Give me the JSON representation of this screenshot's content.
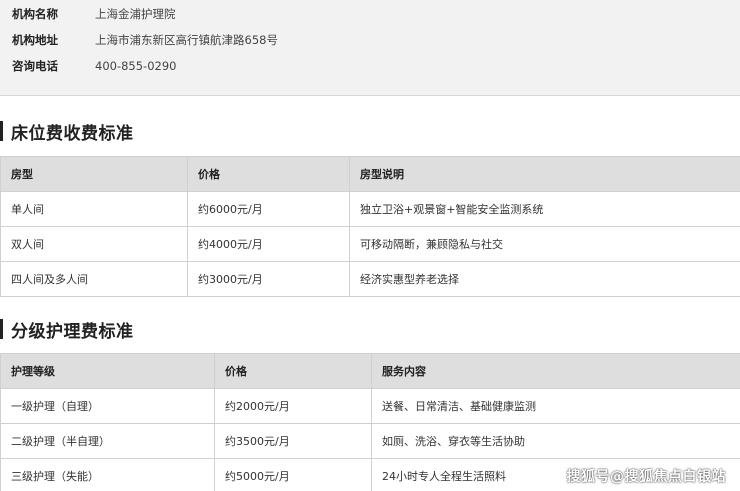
{
  "info": {
    "rows": [
      {
        "label": "机构名称",
        "value": "上海金浦护理院"
      },
      {
        "label": "机构地址",
        "value": "上海市浦东新区高行镇航津路658号"
      },
      {
        "label": "咨询电话",
        "value": "400-855-0290"
      }
    ]
  },
  "bed_section": {
    "title": "床位费收费标准",
    "headers": [
      "房型",
      "价格",
      "房型说明"
    ],
    "rows": [
      [
        "单人间",
        "约6000元/月",
        "独立卫浴+观景窗+智能安全监测系统"
      ],
      [
        "双人间",
        "约4000元/月",
        "可移动隔断，兼顾隐私与社交"
      ],
      [
        "四人间及多人间",
        "约3000元/月",
        "经济实惠型养老选择"
      ]
    ]
  },
  "care_section": {
    "title": "分级护理费标准",
    "headers": [
      "护理等级",
      "价格",
      "服务内容"
    ],
    "rows": [
      [
        "一级护理（自理）",
        "约2000元/月",
        "送餐、日常清洁、基础健康监测"
      ],
      [
        "二级护理（半自理）",
        "约3500元/月",
        "如厕、洗浴、穿衣等生活协助"
      ],
      [
        "三级护理（失能）",
        "约5000元/月",
        "24小时专人全程生活照料"
      ]
    ]
  },
  "watermark": "搜狐号@搜狐焦点白银站"
}
